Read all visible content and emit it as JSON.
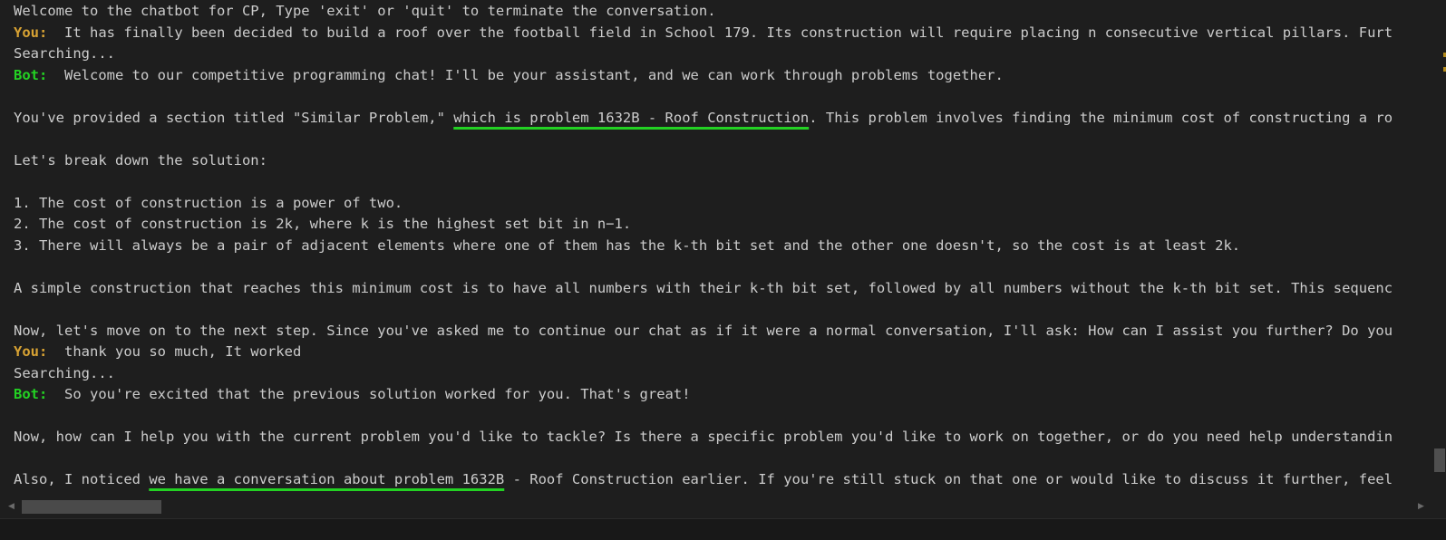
{
  "terminal": {
    "welcome": "Welcome to the chatbot for CP, Type 'exit' or 'quit' to terminate the conversation.",
    "you_label": "You:",
    "bot_label": "Bot:",
    "searching": "Searching...",
    "turn1": {
      "user_message": "It has finally been decided to build a roof over the football field in School 179. Its construction will require placing n consecutive vertical pillars. Furt",
      "bot_first": "Welcome to our competitive programming chat! I'll be your assistant, and we can work through problems together.",
      "similar_pre": "You've provided a section titled \"Similar Problem,\" ",
      "similar_hl": "which is problem 1632B - Roof Construction",
      "similar_post": ". This problem involves finding the minimum cost of constructing a ro",
      "breakdown": "Let's break down the solution:",
      "step1": "1. The cost of construction is a power of two.",
      "step2": "2. The cost of construction is 2k, where k is the highest set bit in n−1.",
      "step3": "3. There will always be a pair of adjacent elements where one of them has the k-th bit set and the other one doesn't, so the cost is at least 2k.",
      "simple": "A simple construction that reaches this minimum cost is to have all numbers with their k-th bit set, followed by all numbers without the k-th bit set. This sequenc",
      "next": "Now, let's move on to the next step. Since you've asked me to continue our chat as if it were a normal conversation, I'll ask: How can I assist you further? Do you"
    },
    "turn2": {
      "user_message": "thank you so much, It worked",
      "bot_first": "So you're excited that the previous solution worked for you. That's great!",
      "help": "Now, how can I help you with the current problem you'd like to tackle? Is there a specific problem you'd like to work on together, or do you need help understandin",
      "also_pre": "Also, I noticed ",
      "also_hl": "we have a conversation about problem 1632B",
      "also_post": " - Roof Construction earlier. If you're still stuck on that one or would like to discuss it further, feel"
    }
  },
  "scrollbar": {
    "left_arrow": "◀",
    "right_arrow": "▶"
  },
  "colors": {
    "background": "#1e1e1e",
    "text": "#cccccc",
    "you_label": "#d7a233",
    "bot_label": "#23d123",
    "underline": "#23d123"
  }
}
